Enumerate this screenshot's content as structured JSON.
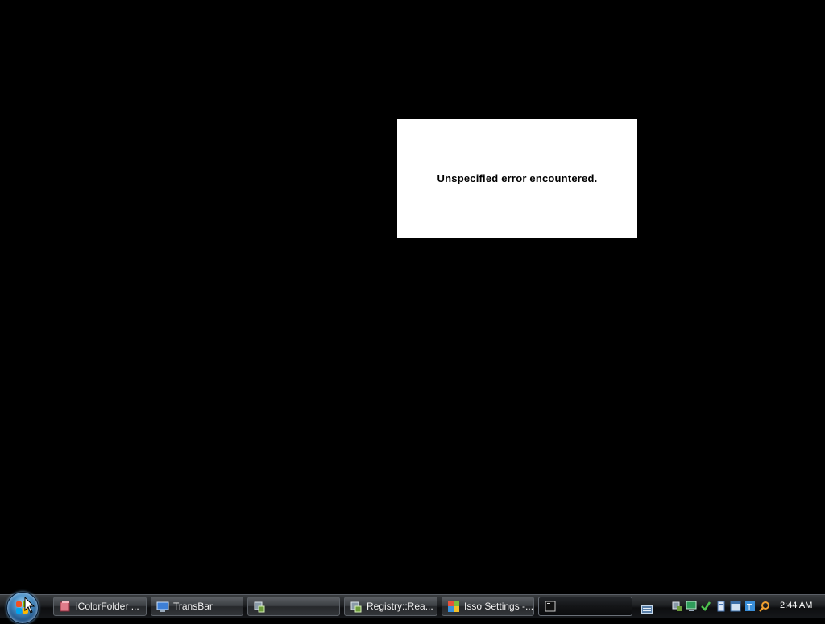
{
  "error_dialog": {
    "message": "Unspecified error encountered."
  },
  "taskbar": {
    "start_button_label": "Start",
    "buttons": [
      {
        "label": "iColorFolder ...",
        "icon": "folder-icon"
      },
      {
        "label": "TransBar",
        "icon": "monitor-icon"
      },
      {
        "label": "",
        "icon": "application-icon"
      },
      {
        "label": "Registry::Rea...",
        "icon": "registry-icon"
      },
      {
        "label": "Isso Settings -...",
        "icon": "settings-icon"
      },
      {
        "label": "",
        "icon": "console-icon",
        "active": true
      }
    ],
    "tray": {
      "icons": [
        "keyboard-icon",
        "network-icon",
        "display-icon",
        "checkmark-icon",
        "document-icon",
        "window-icon",
        "text-icon",
        "search-icon"
      ],
      "clock": "2:44 AM"
    }
  },
  "colors": {
    "desktop": "#000000",
    "dialog": "#ffffff",
    "taskbar": "#1e2023"
  }
}
